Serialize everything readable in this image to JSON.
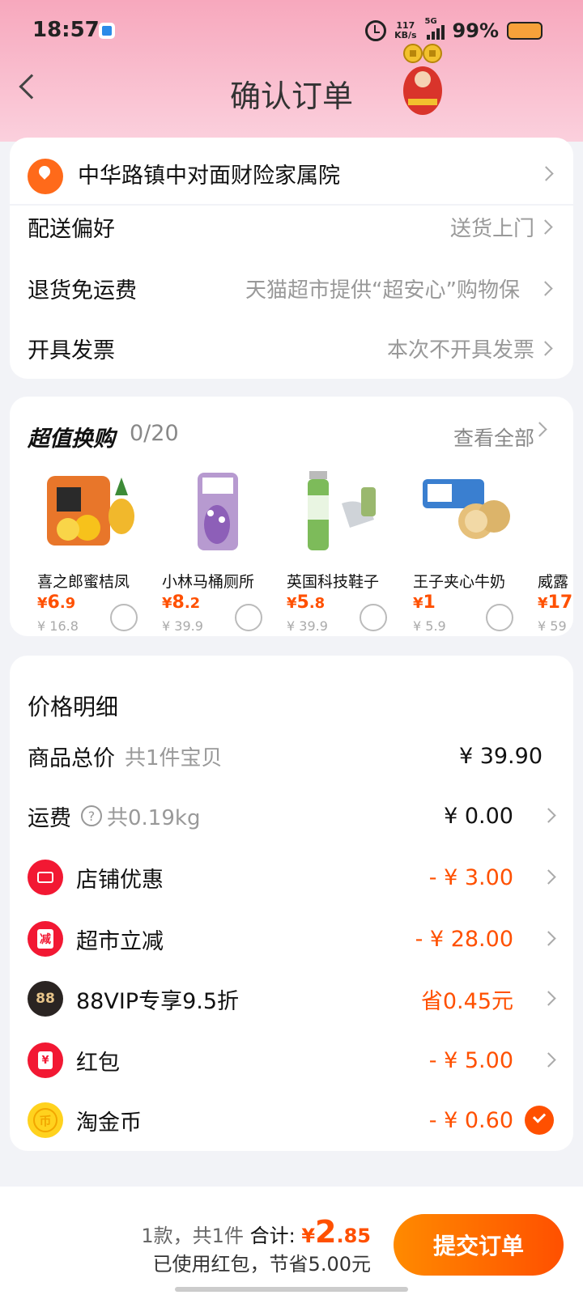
{
  "status_bar": {
    "time": "18:57",
    "net_speed_value": "117",
    "net_speed_unit": "KB/s",
    "signal_label": "5G",
    "battery": "99%"
  },
  "header": {
    "title": "确认订单"
  },
  "address": {
    "text": "中华路镇中对面财险家属院"
  },
  "options": [
    {
      "label": "配送偏好",
      "value": "送货上门"
    },
    {
      "label": "退货免运费",
      "value": "天猫超市提供“超安心”购物保"
    },
    {
      "label": "开具发票",
      "value": "本次不开具发票"
    }
  ],
  "exchange": {
    "title": "超值换购",
    "count": "0/20",
    "view_all": "查看全部",
    "products": [
      {
        "name": "喜之郎蜜桔凤",
        "price_symbol": "¥",
        "price_int": "6",
        "price_dec": ".9",
        "orig": "¥ 16.8"
      },
      {
        "name": "小林马桶厕所",
        "price_symbol": "¥",
        "price_int": "8",
        "price_dec": ".2",
        "orig": "¥ 39.9"
      },
      {
        "name": "英国科技鞋子",
        "price_symbol": "¥",
        "price_int": "5",
        "price_dec": ".8",
        "orig": "¥ 39.9"
      },
      {
        "name": "王子夹心牛奶",
        "price_symbol": "¥",
        "price_int": "1",
        "price_dec": "",
        "orig": "¥ 5.9"
      },
      {
        "name": "威露",
        "price_symbol": "¥",
        "price_int": "17",
        "price_dec": "",
        "orig": "¥ 59"
      }
    ]
  },
  "price_detail": {
    "title": "价格明细",
    "goods_total": {
      "label": "商品总价",
      "sub": "共1件宝贝",
      "amount": "¥ 39.90"
    },
    "shipping": {
      "label": "运费",
      "sub": "共0.19kg",
      "amount": "¥ 0.00"
    },
    "store_discount": {
      "label": "店铺优惠",
      "amount": "- ¥ 3.00"
    },
    "market_discount": {
      "label": "超市立减",
      "icon_text": "减",
      "amount": "- ¥ 28.00"
    },
    "vip": {
      "label": "88VIP专享9.5折",
      "icon_text": "88",
      "amount": "省0.45元"
    },
    "red_packet": {
      "label": "红包",
      "icon_text": "¥",
      "amount": "- ¥ 5.00"
    },
    "coins": {
      "label": "淘金币",
      "icon_text": "币",
      "amount": "- ¥ 0.60"
    }
  },
  "bottom": {
    "count_text": "1款，共1件",
    "total_label": "合计:",
    "total_symbol": "¥",
    "total_int": "2",
    "total_dec": ".85",
    "saved_text": "已使用红包，节省5.00元",
    "submit_label": "提交订单"
  }
}
